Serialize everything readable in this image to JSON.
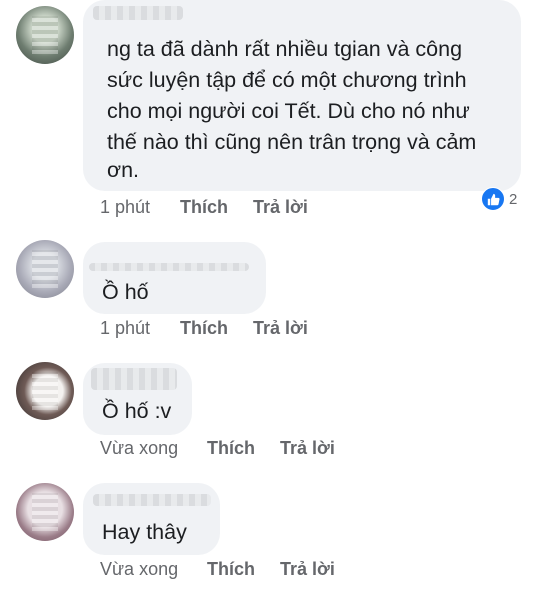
{
  "comments": [
    {
      "text_lines": [
        "ng ta đã dành rất nhiều tgian và công",
        "sức luyện tập để có một chương trình",
        "cho mọi người coi Tết. Dù cho nó như",
        "thế nào thì cũng nên trân trọng và cảm",
        "ơn."
      ],
      "time": "1 phút",
      "like_label": "Thích",
      "reply_label": "Trả lời",
      "reaction_count": "2"
    },
    {
      "text_lines": [
        "Ồ hố"
      ],
      "time": "1 phút",
      "like_label": "Thích",
      "reply_label": "Trả lời"
    },
    {
      "text_lines": [
        "Ồ hố :v"
      ],
      "time": "Vừa xong",
      "like_label": "Thích",
      "reply_label": "Trả lời"
    },
    {
      "text_lines": [
        "Hay thây"
      ],
      "time": "Vừa xong",
      "like_label": "Thích",
      "reply_label": "Trả lời"
    }
  ],
  "colors": {
    "bubble": "#f0f2f5",
    "meta_text": "#65676b",
    "like_blue": "#1877f2"
  }
}
